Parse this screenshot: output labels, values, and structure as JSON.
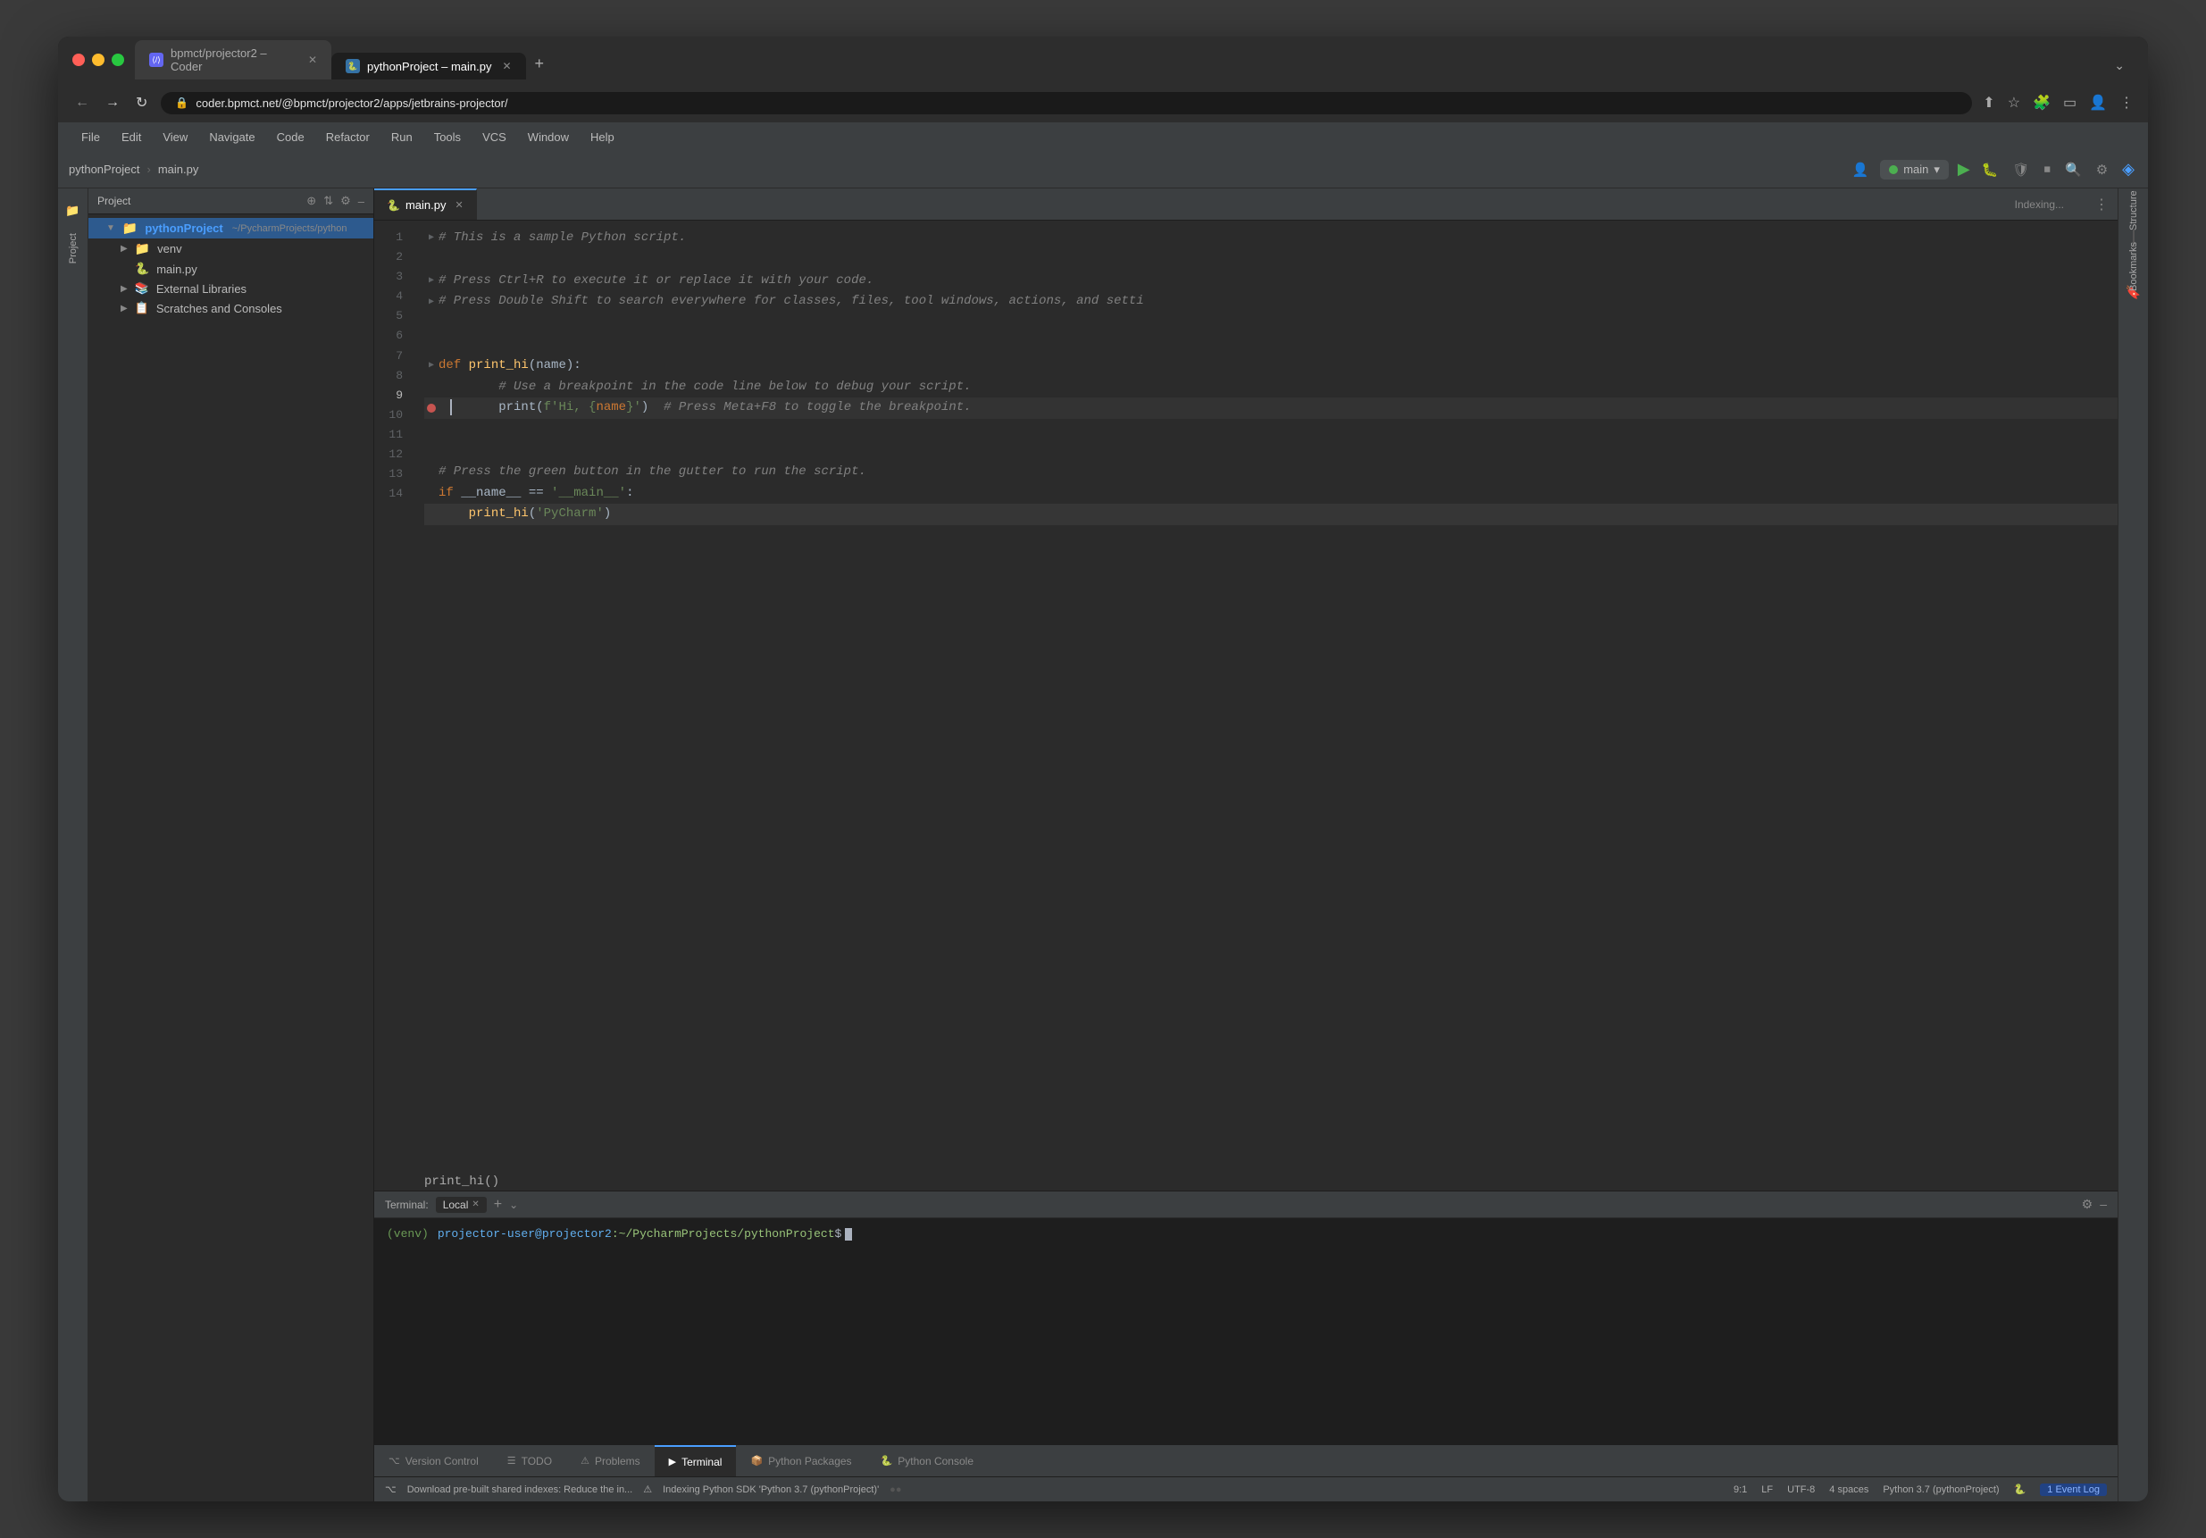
{
  "browser": {
    "tabs": [
      {
        "id": "tab1",
        "label": "bpmct/projector2 – Coder",
        "icon": "coder",
        "active": false
      },
      {
        "id": "tab2",
        "label": "pythonProject – main.py",
        "icon": "py",
        "active": true
      }
    ],
    "address": "coder.bpmct.net/@bpmct/projector2/apps/jetbrains-projector/",
    "new_tab_label": "+",
    "dropdown_label": "⌄"
  },
  "nav": {
    "back": "←",
    "forward": "→",
    "refresh": "↻"
  },
  "menu": {
    "items": [
      "File",
      "Edit",
      "View",
      "Navigate",
      "Code",
      "Refactor",
      "Run",
      "Tools",
      "VCS",
      "Window",
      "Help"
    ]
  },
  "ide_toolbar": {
    "project_name": "pythonProject",
    "file_name": "main.py",
    "run_config": "main",
    "indexing_label": "Indexing..."
  },
  "project_panel": {
    "title": "Project",
    "root": "pythonProject",
    "root_path": "~/PycharmProjects/python",
    "items": [
      {
        "id": "venv",
        "label": "venv",
        "type": "folder",
        "indent": 1,
        "expanded": false
      },
      {
        "id": "main.py",
        "label": "main.py",
        "type": "py",
        "indent": 2
      },
      {
        "id": "ext_libs",
        "label": "External Libraries",
        "type": "folder",
        "indent": 1,
        "expanded": false
      },
      {
        "id": "scratches",
        "label": "Scratches and Consoles",
        "type": "folder",
        "indent": 1,
        "expanded": false
      }
    ]
  },
  "editor": {
    "tab_name": "main.py",
    "lines": [
      {
        "num": 1,
        "fold": true,
        "content": "# This is a sample Python script.",
        "type": "comment"
      },
      {
        "num": 2,
        "content": ""
      },
      {
        "num": 3,
        "fold": true,
        "content": "# Press Ctrl+R to execute it or replace it with your code.",
        "type": "comment"
      },
      {
        "num": 4,
        "fold": true,
        "content": "# Press Double Shift to search everywhere for classes, files, tool windows, actions, and setti",
        "type": "comment"
      },
      {
        "num": 5,
        "content": ""
      },
      {
        "num": 6,
        "content": ""
      },
      {
        "num": 7,
        "fold": true,
        "content_parts": [
          {
            "t": "keyword",
            "v": "def "
          },
          {
            "t": "function",
            "v": "print_hi"
          },
          {
            "t": "normal",
            "v": "("
          },
          {
            "t": "param",
            "v": "name"
          },
          {
            "t": "normal",
            "v": "):"
          }
        ]
      },
      {
        "num": 8,
        "content": "        # Use a breakpoint in the code line below to debug your script.",
        "type": "comment"
      },
      {
        "num": 9,
        "breakpoint": true,
        "content_parts": [
          {
            "t": "normal",
            "v": "        "
          },
          {
            "t": "builtin",
            "v": "print"
          },
          {
            "t": "normal",
            "v": "("
          },
          {
            "t": "fstring",
            "v": "f'Hi, {"
          },
          {
            "t": "fvar",
            "v": "name"
          },
          {
            "t": "fstring",
            "v": "}'"
          },
          {
            "t": "normal",
            "v": ")  "
          },
          {
            "t": "comment",
            "v": "# Press Meta+F8 to toggle the breakpoint."
          }
        ]
      },
      {
        "num": 10,
        "content": ""
      },
      {
        "num": 11,
        "content": ""
      },
      {
        "num": 12,
        "content": "# Press the green button in the gutter to run the script.",
        "type": "comment"
      },
      {
        "num": 13,
        "content_parts": [
          {
            "t": "keyword",
            "v": "if "
          },
          {
            "t": "dunder",
            "v": "__name__"
          },
          {
            "t": "normal",
            "v": " == "
          },
          {
            "t": "string",
            "v": "'__main__'"
          },
          {
            "t": "normal",
            "v": ":"
          }
        ]
      },
      {
        "num": 14,
        "content_parts": [
          {
            "t": "normal",
            "v": "    "
          },
          {
            "t": "function",
            "v": "print_hi"
          },
          {
            "t": "normal",
            "v": "("
          },
          {
            "t": "string",
            "v": "'PyCharm'"
          },
          {
            "t": "normal",
            "v": ")"
          }
        ],
        "highlighted": true
      }
    ]
  },
  "terminal": {
    "label": "Terminal:",
    "tab_name": "Local",
    "prompt": "(venv) projector-user@projector2:~/PycharmProjects/pythonProject$"
  },
  "bottom_tabs": {
    "tabs": [
      {
        "id": "version_control",
        "label": "Version Control",
        "icon": "⌥",
        "active": false
      },
      {
        "id": "todo",
        "label": "TODO",
        "icon": "☰",
        "active": false
      },
      {
        "id": "problems",
        "label": "Problems",
        "icon": "⚠",
        "active": false
      },
      {
        "id": "terminal",
        "label": "Terminal",
        "icon": "▶",
        "active": true
      },
      {
        "id": "python_packages",
        "label": "Python Packages",
        "icon": "📦",
        "active": false
      },
      {
        "id": "python_console",
        "label": "Python Console",
        "icon": "🐍",
        "active": false
      }
    ]
  },
  "status_bar": {
    "items": [
      {
        "id": "vcs",
        "label": "Download pre-built shared indexes: Reduce the in..."
      },
      {
        "id": "index",
        "label": "Indexing Python SDK 'Python 3.7 (pythonProject)'"
      },
      {
        "id": "progress",
        "label": "●●"
      }
    ],
    "right": {
      "line_col": "9:1",
      "lf": "LF",
      "encoding": "UTF-8",
      "indent": "4 spaces",
      "python": "Python 3.7 (pythonProject)"
    },
    "event_log": "1 Event Log"
  }
}
